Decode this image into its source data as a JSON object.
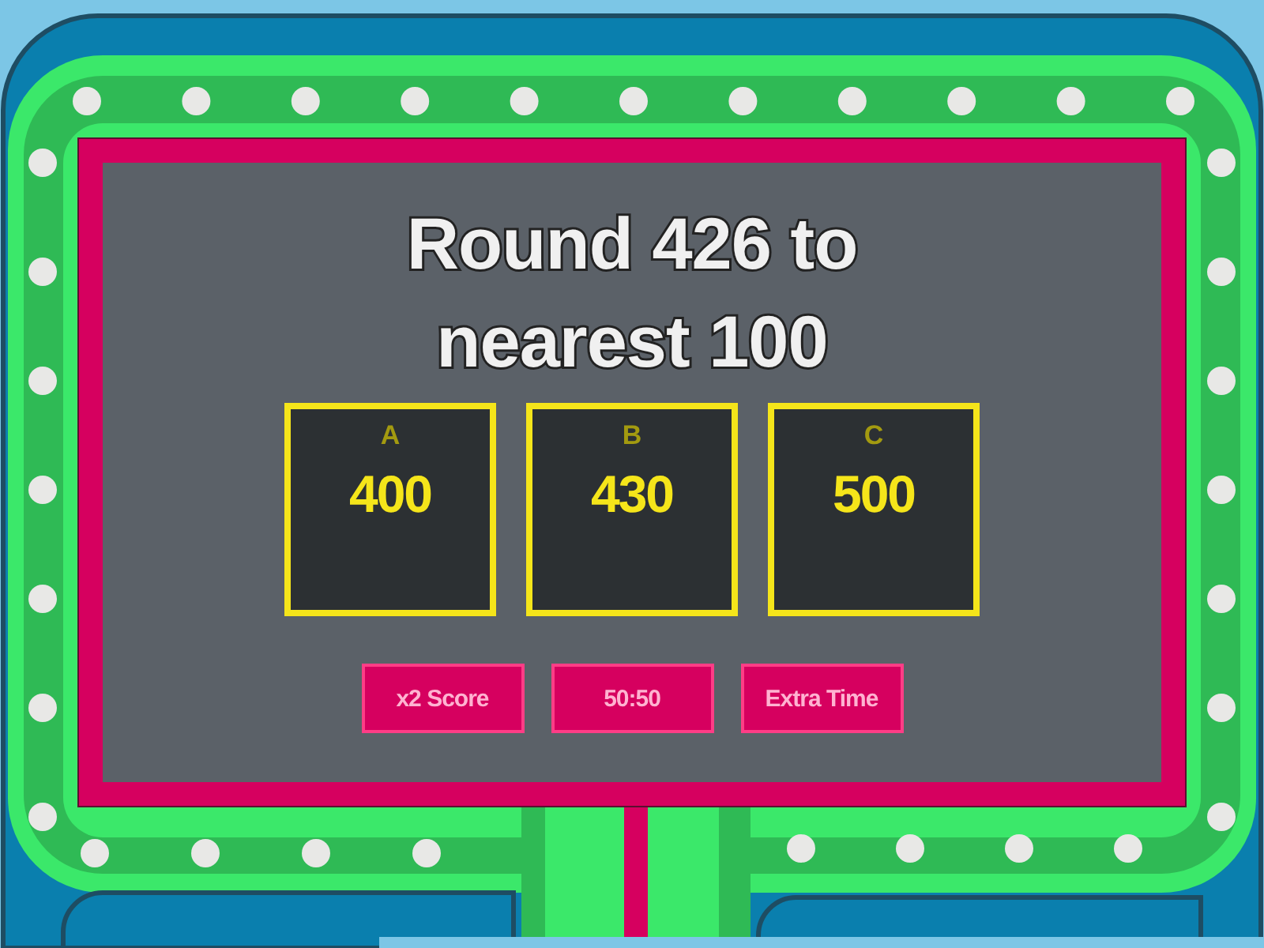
{
  "question": {
    "lines": [
      "Round 426 to",
      "nearest 100"
    ]
  },
  "answers": [
    {
      "letter": "A",
      "value": "400"
    },
    {
      "letter": "B",
      "value": "430"
    },
    {
      "letter": "C",
      "value": "500"
    }
  ],
  "powerups": [
    "x2 Score",
    "50:50",
    "Extra Time"
  ]
}
